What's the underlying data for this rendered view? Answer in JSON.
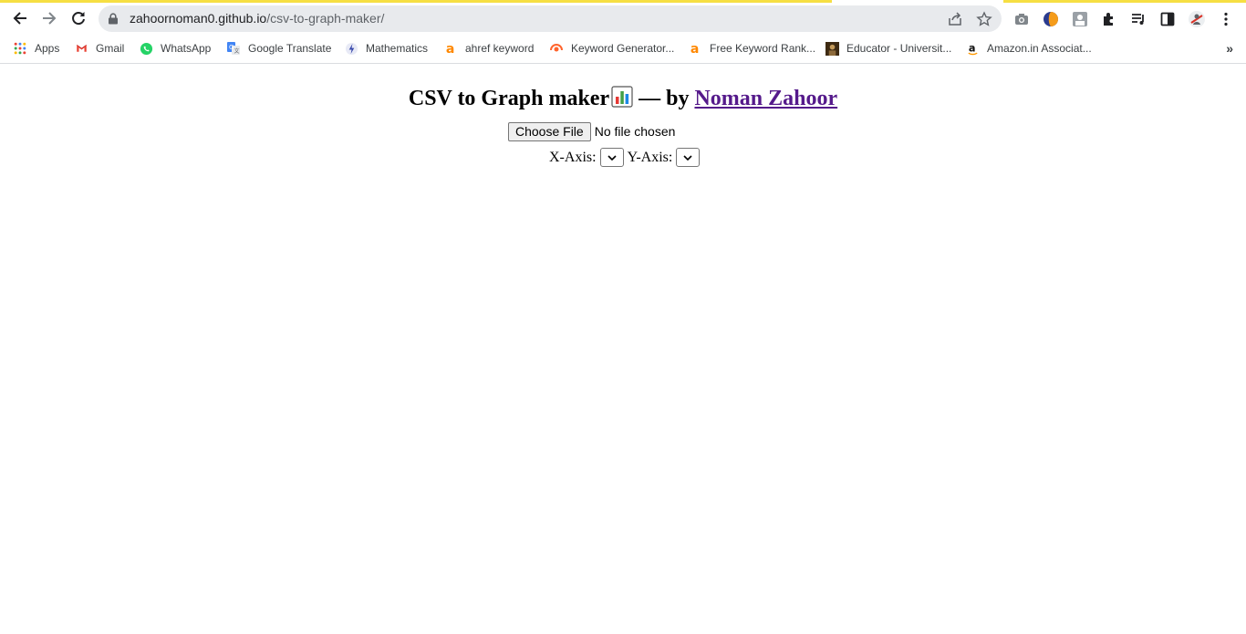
{
  "browser": {
    "url_host": "zahoornoman0.github.io",
    "url_path": "/csv-to-graph-maker/"
  },
  "bookmarks": {
    "items": [
      {
        "label": "Apps",
        "icon": "apps-grid-icon"
      },
      {
        "label": "Gmail",
        "icon": "gmail-icon"
      },
      {
        "label": "WhatsApp",
        "icon": "whatsapp-icon"
      },
      {
        "label": "Google Translate",
        "icon": "translate-icon"
      },
      {
        "label": "Mathematics",
        "icon": "bolt-icon"
      },
      {
        "label": "ahref keyword",
        "icon": "ahrefs-icon"
      },
      {
        "label": "Keyword Generator...",
        "icon": "semrush-icon"
      },
      {
        "label": "Free Keyword Rank...",
        "icon": "ahrefs-icon"
      },
      {
        "label": "Educator - Universit...",
        "icon": "educator-icon"
      },
      {
        "label": "Amazon.in Associat...",
        "icon": "amazon-icon"
      }
    ],
    "more": "»"
  },
  "page": {
    "title": "CSV to Graph maker",
    "title_by": " — by ",
    "author": "Noman Zahoor",
    "choose_file": "Choose File",
    "no_file": "No file chosen",
    "x_axis_label": "X-Axis:",
    "y_axis_label": "Y-Axis:"
  },
  "colors": {
    "loading_bar": "#f6df43",
    "link_visited": "#551a8b",
    "omnibox_bg": "#e8eaed"
  }
}
